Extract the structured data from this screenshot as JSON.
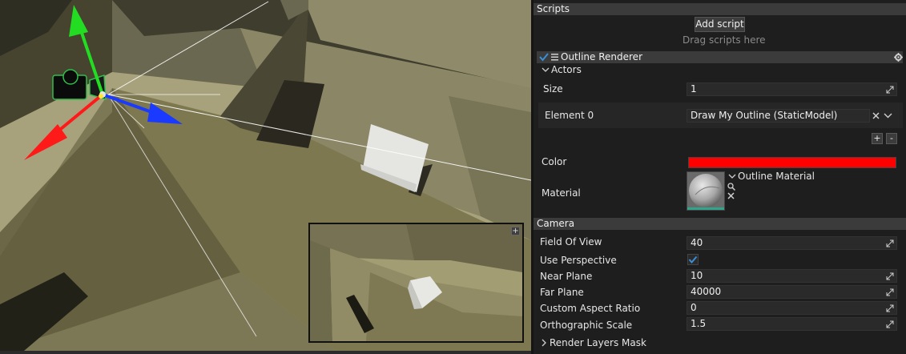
{
  "viewport": {
    "preview_button_label": "+"
  },
  "scripts": {
    "section_title": "Scripts",
    "add_script_label": "Add script",
    "drag_hint": "Drag scripts here"
  },
  "outline_renderer": {
    "title": "Outline Renderer",
    "enabled": true,
    "actors_label": "Actors",
    "size_label": "Size",
    "size_value": "1",
    "element0_label": "Element 0",
    "element0_value": "Draw My Outline (StaticModel)",
    "add_label": "+",
    "remove_label": "-",
    "color_label": "Color",
    "color_value": "#ff0000",
    "material_label": "Material",
    "material_name": "Outline Material"
  },
  "camera": {
    "section_title": "Camera",
    "fov_label": "Field Of View",
    "fov_value": "40",
    "perspective_label": "Use Perspective",
    "perspective_checked": true,
    "near_label": "Near Plane",
    "near_value": "10",
    "far_label": "Far Plane",
    "far_value": "40000",
    "aspect_label": "Custom Aspect Ratio",
    "aspect_value": "0",
    "ortho_label": "Orthographic Scale",
    "ortho_value": "1.5",
    "render_layers_label": "Render Layers Mask"
  },
  "icons": {
    "gizmo": "transform-gizmo-icon",
    "camera": "camera-icon",
    "expand": "expand-arrows-icon",
    "checkmark": "checkmark-icon",
    "gear": "gear-icon",
    "chevron_down": "chevron-down-icon",
    "chevron_right": "chevron-right-icon",
    "clear": "close-icon",
    "search": "search-icon"
  },
  "colors": {
    "accent_check": "#3a8fd6",
    "gizmo_x": "#ff1a1a",
    "gizmo_y": "#22dd22",
    "gizmo_z": "#1a3aff"
  }
}
